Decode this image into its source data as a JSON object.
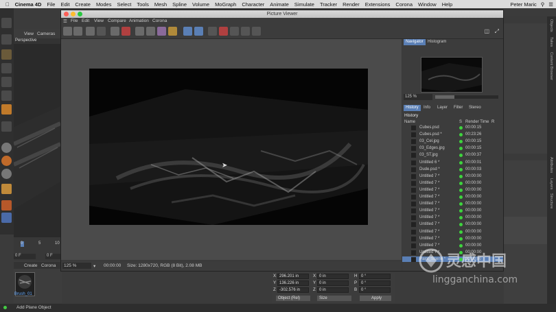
{
  "menubar": {
    "app": "Cinema 4D",
    "items": [
      "File",
      "Edit",
      "Create",
      "Modes",
      "Select",
      "Tools",
      "Mesh",
      "Spline",
      "Volume",
      "MoGraph",
      "Character",
      "Animate",
      "Simulate",
      "Tracker",
      "Render",
      "Extensions",
      "Corona",
      "Window",
      "Help"
    ],
    "user": "Peter Maric"
  },
  "left": {
    "view_label": "View",
    "cameras_label": "Cameras",
    "viewport_label": "Perspective",
    "timeline_ticks": [
      "0",
      "5",
      "10"
    ],
    "frame_field": "0 F",
    "frame_field2": "0 F",
    "material_menu": [
      "Create",
      "Corona"
    ],
    "material_name": "Brush_01",
    "status_text": "Add Plane Object"
  },
  "picture_viewer": {
    "title": "Picture Viewer",
    "menu": [
      "File",
      "Edit",
      "View",
      "Compare",
      "Animation",
      "Corona"
    ],
    "status": {
      "zoom": "125 %",
      "time": "00:00:00",
      "size": "Size: 1280x720, RGB (8 Bit), 2.08 MB"
    },
    "navigator_tabs": [
      "Navigator",
      "Histogram"
    ],
    "nav_zoom": "125 %",
    "history_tabs": [
      "History",
      "Info",
      "Layer",
      "Filter",
      "Stereo"
    ],
    "history_title": "History",
    "history_headers": {
      "name": "Name",
      "s": "S",
      "time": "Render Time",
      "r": "R"
    },
    "history_rows": [
      {
        "name": "Cubes.psd",
        "time": "00:00:15"
      },
      {
        "name": "Cubes.psd *",
        "time": "00:23:26"
      },
      {
        "name": "03_Cel.jpg",
        "time": "00:00:15"
      },
      {
        "name": "03_Edges.jpg",
        "time": "00:00:15"
      },
      {
        "name": "03_ST.jpg",
        "time": "00:00:37"
      },
      {
        "name": "Untitled 6 *",
        "time": "00:00:01"
      },
      {
        "name": "Dude.psd *",
        "time": "00:00:03"
      },
      {
        "name": "Untitled 7 *",
        "time": "00:00:00"
      },
      {
        "name": "Untitled 7 *",
        "time": "00:00:00"
      },
      {
        "name": "Untitled 7 *",
        "time": "00:00:00"
      },
      {
        "name": "Untitled 7 *",
        "time": "00:00:00"
      },
      {
        "name": "Untitled 7 *",
        "time": "00:00:00"
      },
      {
        "name": "Untitled 7 *",
        "time": "00:00:00"
      },
      {
        "name": "Untitled 7 *",
        "time": "00:00:00"
      },
      {
        "name": "Untitled 7 *",
        "time": "00:00:00"
      },
      {
        "name": "Untitled 7 *",
        "time": "00:00:00"
      },
      {
        "name": "Untitled 7 *",
        "time": "00:00:00"
      },
      {
        "name": "Untitled 7 *",
        "time": "00:00:00"
      },
      {
        "name": "Untitled 7 *",
        "time": "00:00:00"
      },
      {
        "name": "Paint_Scene *",
        "time": "00:00:00"
      }
    ]
  },
  "coords": {
    "rows": [
      {
        "a": "X",
        "av": "296.201 in",
        "b": "X",
        "bv": "0 in",
        "c": "H",
        "cv": "0 °"
      },
      {
        "a": "Y",
        "av": "136.226 in",
        "b": "Y",
        "bv": "0 in",
        "c": "P",
        "cv": "0 °"
      },
      {
        "a": "Z",
        "av": "-302.576 in",
        "b": "Z",
        "bv": "0 in",
        "c": "B",
        "cv": "0 °"
      }
    ],
    "mode": "Object (Rel)",
    "size": "Size",
    "apply": "Apply"
  },
  "right_tabs": [
    "Objects",
    "Takes",
    "Content Browser",
    "Attributes",
    "Layers",
    "Structure"
  ],
  "colors": {
    "accent": "#5a7fb5",
    "status_green": "#3ed43e"
  }
}
